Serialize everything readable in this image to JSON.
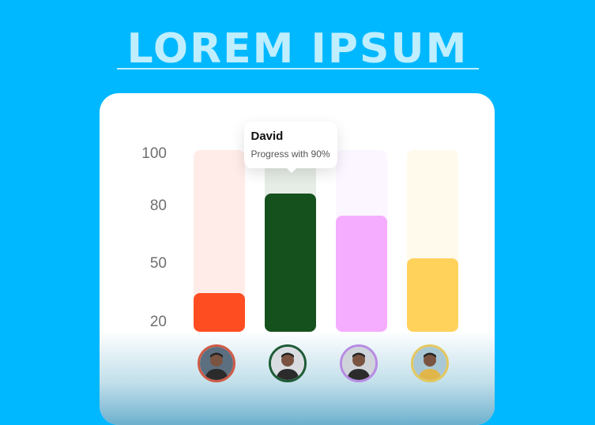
{
  "heading": "LOREM IPSUM",
  "tooltip": {
    "name": "David",
    "text": "Progress with 90%"
  },
  "chart_data": {
    "type": "bar",
    "yticks": [
      "100",
      "80",
      "50",
      "20"
    ],
    "ylim": [
      20,
      100
    ],
    "categories": [
      "",
      "David",
      "",
      ""
    ],
    "values": [
      35,
      90,
      75,
      53
    ],
    "colors": [
      "#ff4d22",
      "#15511d",
      "#f5adff",
      "#ffd25c"
    ],
    "track_colors": [
      "#ffece8",
      "#e6ece6",
      "#fbf6ff",
      "#fffaec"
    ],
    "avatar_colors": [
      "#cf5b45",
      "#1e5b36",
      "#b78be3",
      "#e3c75d"
    ],
    "highlighted": 1
  }
}
